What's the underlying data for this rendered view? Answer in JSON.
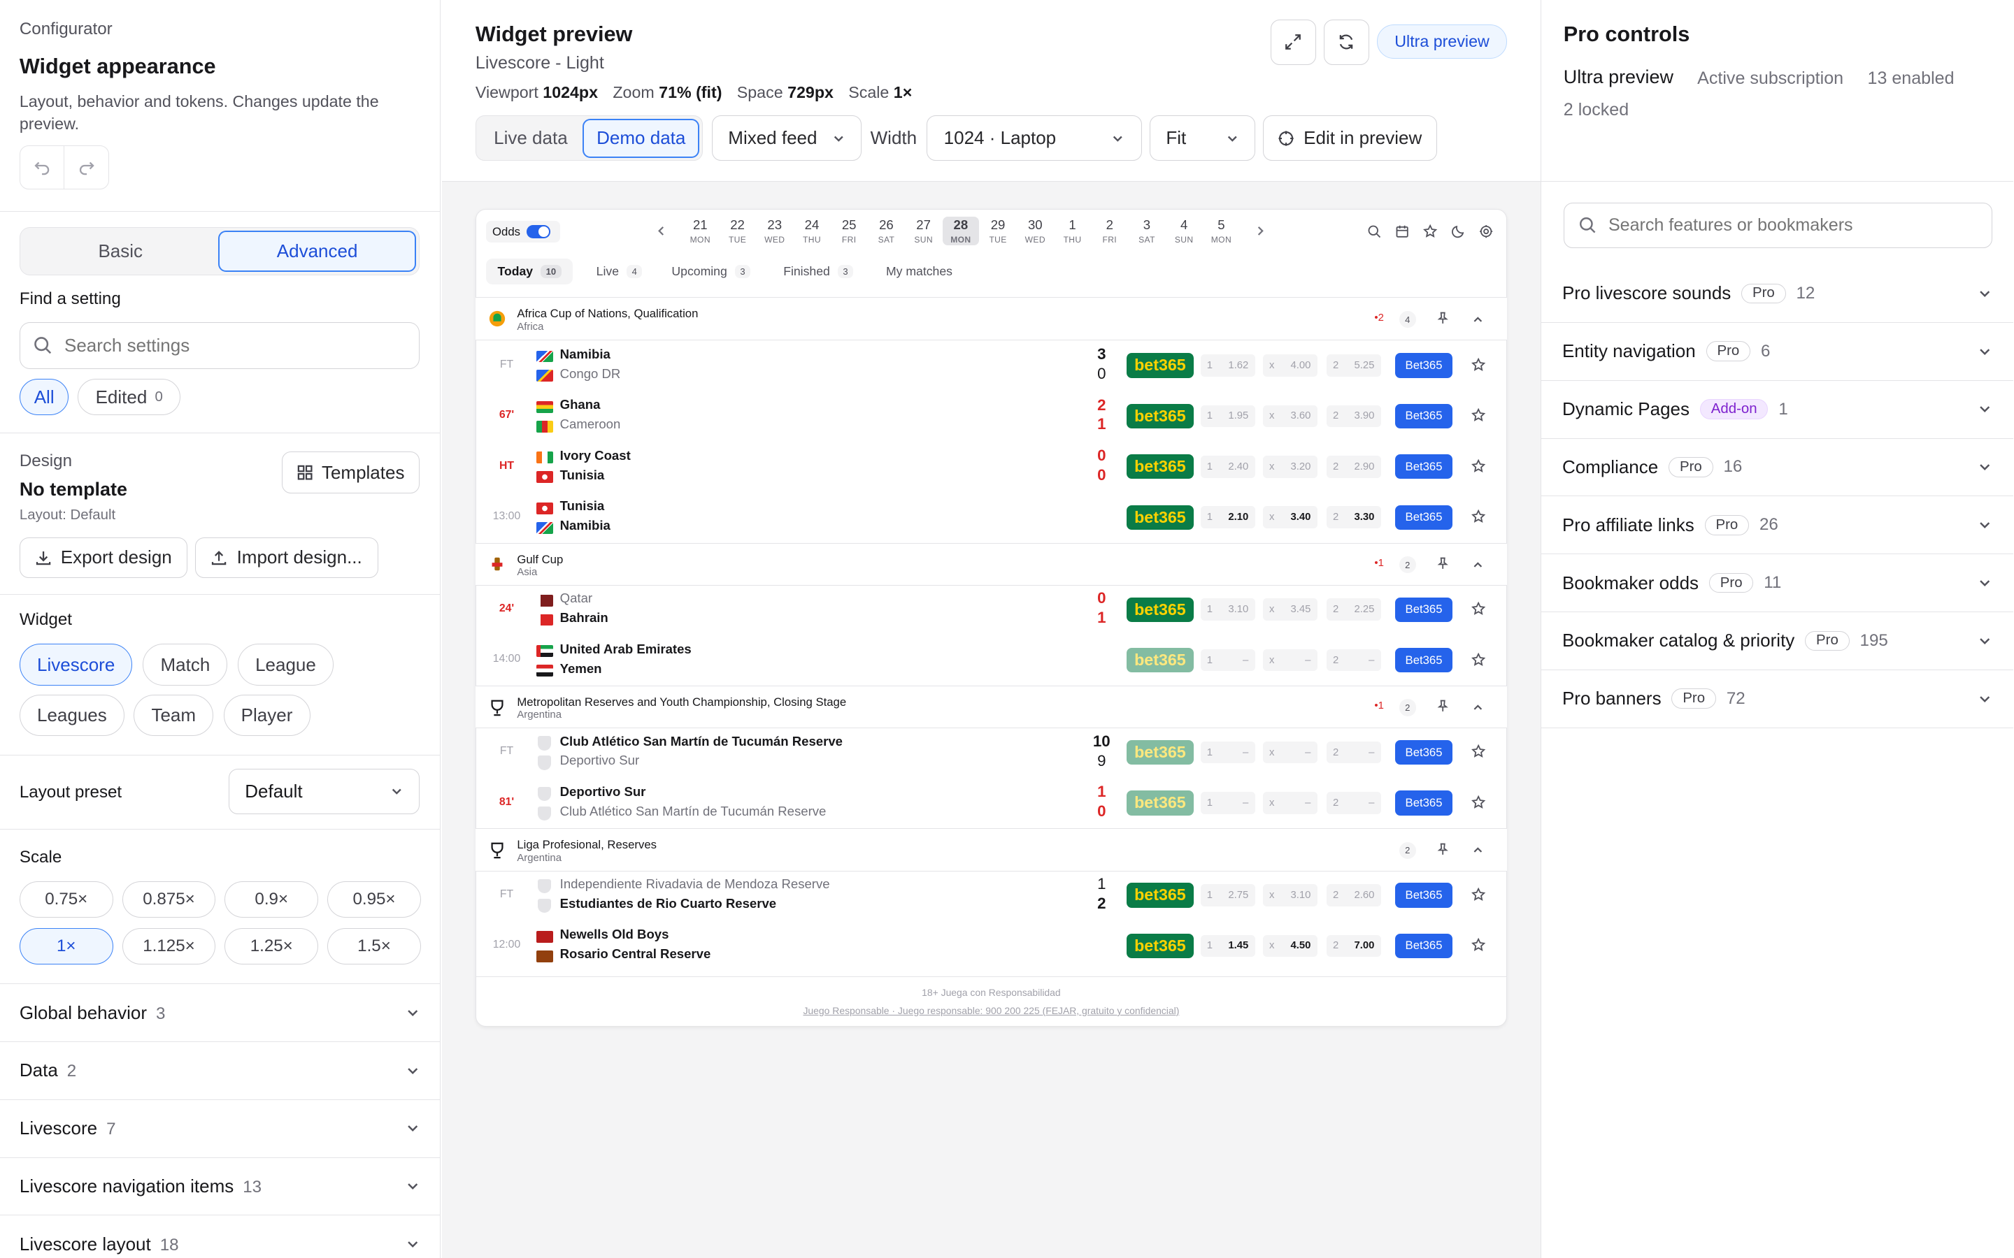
{
  "left": {
    "crumb": "Configurator",
    "title": "Widget appearance",
    "desc": "Layout, behavior and tokens. Changes update the preview.",
    "mode_basic": "Basic",
    "mode_advanced": "Advanced",
    "find_label": "Find a setting",
    "search_placeholder": "Search settings",
    "filter_all": "All",
    "filter_edited": "Edited",
    "edited_count": "0",
    "design_label": "Design",
    "design_value": "No template",
    "design_layout": "Layout: Default",
    "templates_btn": "Templates",
    "export_btn": "Export design",
    "import_btn": "Import design...",
    "widget_label": "Widget",
    "widgets": [
      "Livescore",
      "Match",
      "League",
      "Leagues",
      "Team",
      "Player"
    ],
    "layout_preset_label": "Layout preset",
    "layout_preset_value": "Default",
    "scale_label": "Scale",
    "scales": [
      "0.75×",
      "0.875×",
      "0.9×",
      "0.95×",
      "1×",
      "1.125×",
      "1.25×",
      "1.5×"
    ],
    "sections": [
      {
        "name": "Global behavior",
        "count": "3"
      },
      {
        "name": "Data",
        "count": "2"
      },
      {
        "name": "Livescore",
        "count": "7"
      },
      {
        "name": "Livescore navigation items",
        "count": "13"
      },
      {
        "name": "Livescore layout",
        "count": "18"
      }
    ]
  },
  "mid": {
    "title": "Widget preview",
    "subtitle": "Livescore - Light",
    "viewport_label": "Viewport",
    "viewport_value": "1024px",
    "zoom_label": "Zoom",
    "zoom_value": "71% (fit)",
    "space_label": "Space",
    "space_value": "729px",
    "scale_label": "Scale",
    "scale_value": "1×",
    "ultra_btn": "Ultra preview",
    "live_data": "Live data",
    "demo_data": "Demo data",
    "feed": "Mixed feed",
    "width_label": "Width",
    "width_value": "1024 · Laptop",
    "fit_value": "Fit",
    "edit_btn": "Edit in preview"
  },
  "widget": {
    "odds_label": "Odds",
    "dates": [
      {
        "d": "21",
        "n": "MON"
      },
      {
        "d": "22",
        "n": "TUE"
      },
      {
        "d": "23",
        "n": "WED"
      },
      {
        "d": "24",
        "n": "THU"
      },
      {
        "d": "25",
        "n": "FRI"
      },
      {
        "d": "26",
        "n": "SAT"
      },
      {
        "d": "27",
        "n": "SUN"
      },
      {
        "d": "28",
        "n": "MON"
      },
      {
        "d": "29",
        "n": "TUE"
      },
      {
        "d": "30",
        "n": "WED"
      },
      {
        "d": "1",
        "n": "THU"
      },
      {
        "d": "2",
        "n": "FRI"
      },
      {
        "d": "3",
        "n": "SAT"
      },
      {
        "d": "4",
        "n": "SUN"
      },
      {
        "d": "5",
        "n": "MON"
      }
    ],
    "tabs": [
      {
        "label": "Today",
        "badge": "10"
      },
      {
        "label": "Live",
        "badge": "4"
      },
      {
        "label": "Upcoming",
        "badge": "3"
      },
      {
        "label": "Finished",
        "badge": "3"
      },
      {
        "label": "My matches",
        "badge": ""
      }
    ],
    "competitions": [
      {
        "name": "Africa Cup of Nations, Qualification",
        "region": "Africa",
        "live": "2",
        "count": "4"
      },
      {
        "name": "Gulf Cup",
        "region": "Asia",
        "live": "1",
        "count": "2"
      },
      {
        "name": "Metropolitan Reserves and Youth Championship, Closing Stage",
        "region": "Argentina",
        "live": "1",
        "count": "2"
      },
      {
        "name": "Liga Profesional, Reserves",
        "region": "Argentina",
        "live": "",
        "count": "2"
      }
    ],
    "matches": [
      {
        "status": "FT",
        "home": "Namibia",
        "away": "Congo DR",
        "hs": "3",
        "as": "0",
        "o1": "1.62",
        "ox": "4.00",
        "o2": "5.25"
      },
      {
        "status": "67'",
        "home": "Ghana",
        "away": "Cameroon",
        "hs": "2",
        "as": "1",
        "o1": "1.95",
        "ox": "3.60",
        "o2": "3.90"
      },
      {
        "status": "HT",
        "home": "Ivory Coast",
        "away": "Tunisia",
        "hs": "0",
        "as": "0",
        "o1": "2.40",
        "ox": "3.20",
        "o2": "2.90"
      },
      {
        "status": "13:00",
        "home": "Tunisia",
        "away": "Namibia",
        "hs": "",
        "as": "",
        "o1": "2.10",
        "ox": "3.40",
        "o2": "3.30"
      },
      {
        "status": "24'",
        "home": "Qatar",
        "away": "Bahrain",
        "hs": "0",
        "as": "1",
        "o1": "3.10",
        "ox": "3.45",
        "o2": "2.25"
      },
      {
        "status": "14:00",
        "home": "United Arab Emirates",
        "away": "Yemen",
        "hs": "",
        "as": "",
        "o1": "–",
        "ox": "–",
        "o2": "–"
      },
      {
        "status": "FT",
        "home": "Club Atlético San Martín de Tucumán Reserve",
        "away": "Deportivo Sur",
        "hs": "10",
        "as": "9",
        "o1": "–",
        "ox": "–",
        "o2": "–"
      },
      {
        "status": "81'",
        "home": "Deportivo Sur",
        "away": "Club Atlético San Martín de Tucumán Reserve",
        "hs": "1",
        "as": "0",
        "o1": "–",
        "ox": "–",
        "o2": "–"
      },
      {
        "status": "FT",
        "home": "Independiente Rivadavia de Mendoza Reserve",
        "away": "Estudiantes de Rio Cuarto Reserve",
        "hs": "1",
        "as": "2",
        "o1": "2.75",
        "ox": "3.10",
        "o2": "2.60"
      },
      {
        "status": "12:00",
        "home": "Newells Old Boys",
        "away": "Rosario Central Reserve",
        "hs": "",
        "as": "",
        "o1": "1.45",
        "ox": "4.50",
        "o2": "7.00"
      }
    ],
    "odds_keys": {
      "one": "1",
      "x": "x",
      "two": "2"
    },
    "bookmaker_logo": "bet365",
    "bookmaker_btn": "Bet365",
    "footer1": "18+ Juega con Responsabilidad",
    "footer2": "Juego Responsable · Juego responsable: 900 200 225 (FEJAR, gratuito y confidencial)"
  },
  "right": {
    "title": "Pro controls",
    "plan": "Ultra preview",
    "sub": "Active subscription",
    "enabled": "13 enabled",
    "locked": "2 locked",
    "search_placeholder": "Search features or bookmakers",
    "features": [
      {
        "name": "Pro livescore sounds",
        "tag": "Pro",
        "count": "12"
      },
      {
        "name": "Entity navigation",
        "tag": "Pro",
        "count": "6"
      },
      {
        "name": "Dynamic Pages",
        "tag": "Add-on",
        "count": "1"
      },
      {
        "name": "Compliance",
        "tag": "Pro",
        "count": "16"
      },
      {
        "name": "Pro affiliate links",
        "tag": "Pro",
        "count": "26"
      },
      {
        "name": "Bookmaker odds",
        "tag": "Pro",
        "count": "11"
      },
      {
        "name": "Bookmaker catalog & priority",
        "tag": "Pro",
        "count": "195"
      },
      {
        "name": "Pro banners",
        "tag": "Pro",
        "count": "72"
      }
    ]
  }
}
